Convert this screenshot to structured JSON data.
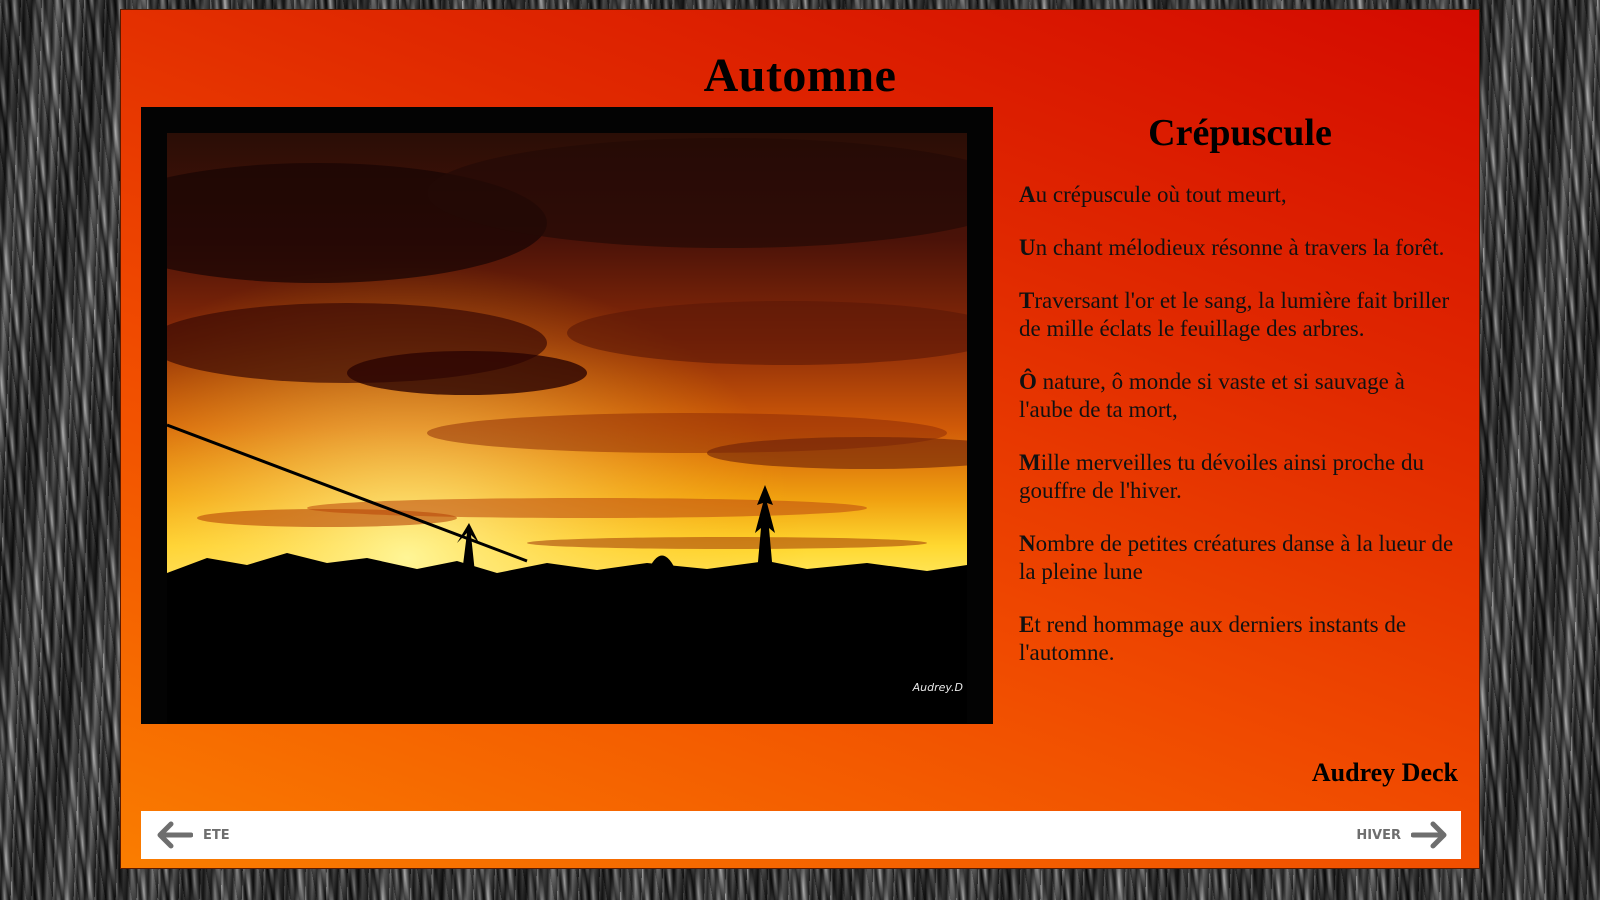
{
  "page": {
    "title": "Automne"
  },
  "photo": {
    "watermark": "Audrey.D"
  },
  "poem": {
    "title": "Crépuscule",
    "stanzas": [
      {
        "initial": "A",
        "rest": "u crépuscule où tout meurt,"
      },
      {
        "initial": "U",
        "rest": "n chant mélodieux résonne à travers la forêt."
      },
      {
        "initial": "T",
        "rest": "raversant l'or et le sang, la lumière fait briller de mille éclats le feuillage des arbres."
      },
      {
        "initial": "Ô",
        "rest": " nature, ô monde si vaste et si sauvage à l'aube de ta mort,"
      },
      {
        "initial": "M",
        "rest": "ille merveilles tu dévoiles ainsi proche du gouffre de l'hiver."
      },
      {
        "initial": "N",
        "rest": "ombre de petites créatures danse à la lueur de la pleine lune"
      },
      {
        "initial": "E",
        "rest": "t rend hommage aux derniers instants de l'automne."
      }
    ],
    "author": "Audrey Deck"
  },
  "nav": {
    "prev_label": "ETE",
    "next_label": "HIVER",
    "prev_icon": "arrow-left-icon",
    "next_icon": "arrow-right-icon"
  },
  "colors": {
    "panel_gradient_start": "#fa7d00",
    "panel_gradient_end": "#d40a00",
    "nav_text": "#6e6e6e"
  }
}
